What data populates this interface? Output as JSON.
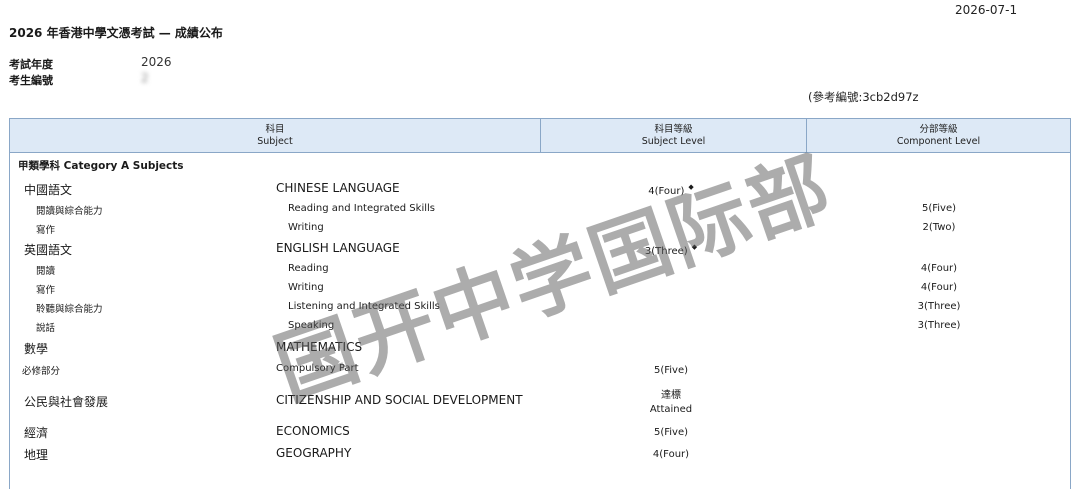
{
  "header": {
    "date": "2026-07-1",
    "title": "2026 年香港中學文憑考試 — 成績公布",
    "exam_year_label": "考試年度",
    "exam_year_value": "2026",
    "candidate_no_label": "考生編號",
    "candidate_no_value": "2",
    "reference": "(參考編號:3cb2d97z"
  },
  "table": {
    "columns": [
      {
        "zh": "科目",
        "en": "Subject"
      },
      {
        "zh": "科目等級",
        "en": "Subject Level"
      },
      {
        "zh": "分部等級",
        "en": "Component Level"
      }
    ],
    "category": "甲類學科 Category A Subjects",
    "rows": [
      {
        "zh": "中國語文",
        "en": "CHINESE LANGUAGE",
        "level": "4(Four)",
        "marker": "◆"
      },
      {
        "zh": "閱讀與綜合能力",
        "en": "Reading and Integrated Skills",
        "component": "5(Five)"
      },
      {
        "zh": "寫作",
        "en": "Writing",
        "component": "2(Two)"
      },
      {
        "zh": "英國語文",
        "en": "ENGLISH LANGUAGE",
        "level": "3(Three)",
        "marker": "◆"
      },
      {
        "zh": "閱讀",
        "en": "Reading",
        "component": "4(Four)"
      },
      {
        "zh": "寫作",
        "en": "Writing",
        "component": "4(Four)"
      },
      {
        "zh": "聆聽與綜合能力",
        "en": "Listening and Integrated Skills",
        "component": "3(Three)"
      },
      {
        "zh": "說話",
        "en": "Speaking",
        "component": "3(Three)"
      },
      {
        "zh": "數學",
        "en": "MATHEMATICS"
      },
      {
        "zh": "必修部分",
        "en": "Compulsory Part",
        "level": "5(Five)"
      },
      {
        "zh": "公民與社會發展",
        "en": "CITIZENSHIP AND SOCIAL DEVELOPMENT",
        "level_zh": "達標",
        "level": "Attained"
      },
      {
        "zh": "經濟",
        "en": "ECONOMICS",
        "level": "5(Five)"
      },
      {
        "zh": "地理",
        "en": "GEOGRAPHY",
        "level": "4(Four)"
      }
    ]
  },
  "watermark": "国开中学国际部"
}
